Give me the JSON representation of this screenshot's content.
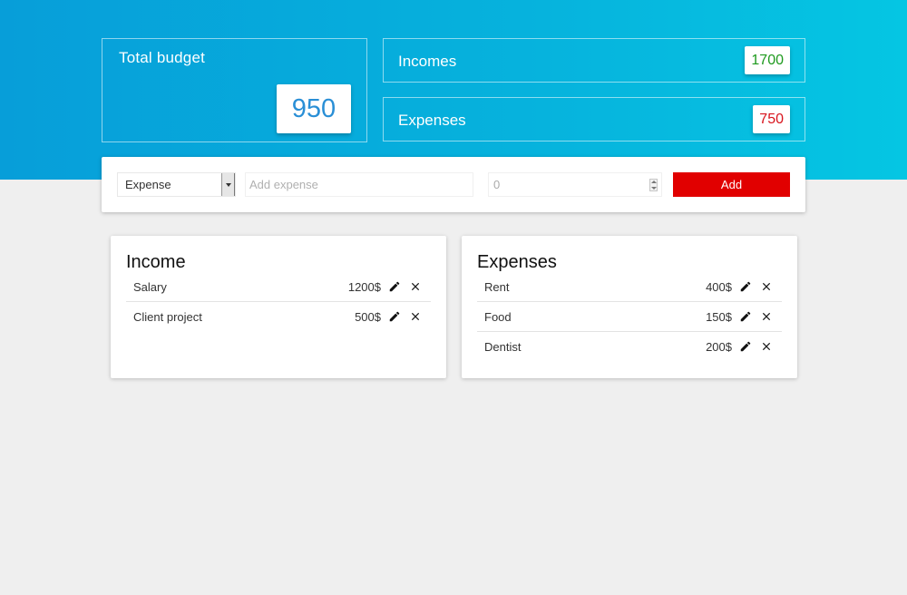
{
  "budget": {
    "total_label": "Total budget",
    "total_value": "950",
    "incomes_label": "Incomes",
    "incomes_value": "1700",
    "expenses_label": "Expenses",
    "expenses_value": "750"
  },
  "form": {
    "type_selected": "Expense",
    "description_placeholder": "Add expense",
    "amount_value": "0",
    "add_label": "Add"
  },
  "income": {
    "title": "Income",
    "items": [
      {
        "name": "Salary",
        "amount": "1200$"
      },
      {
        "name": "Client project",
        "amount": "500$"
      }
    ]
  },
  "expenses": {
    "title": "Expenses",
    "items": [
      {
        "name": "Rent",
        "amount": "400$"
      },
      {
        "name": "Food",
        "amount": "150$"
      },
      {
        "name": "Dentist",
        "amount": "200$"
      }
    ]
  },
  "colors": {
    "header_gradient_start": "#079ed9",
    "header_gradient_end": "#05c6e3",
    "income_green": "#1e9a1e",
    "expense_red": "#d8141d",
    "add_button": "#e10000",
    "budget_blue": "#2a8fd6"
  },
  "icons": {
    "edit": "pencil-icon",
    "delete": "close-icon",
    "dropdown": "chevron-down-icon"
  }
}
